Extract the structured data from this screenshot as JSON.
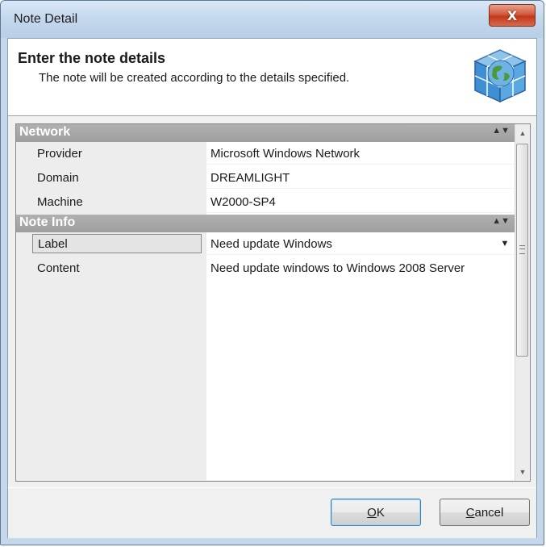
{
  "window": {
    "title": "Note Detail",
    "close_glyph": "X"
  },
  "header": {
    "title": "Enter the note details",
    "subtitle": "The note will be created according to the details specified.",
    "icon": "cube-globe-icon"
  },
  "property_grid": {
    "categories": [
      {
        "label": "Network",
        "rows": [
          {
            "name": "Provider",
            "value": "Microsoft Windows Network"
          },
          {
            "name": "Domain",
            "value": "DREAMLIGHT"
          },
          {
            "name": "Machine",
            "value": "W2000-SP4"
          }
        ]
      },
      {
        "label": "Note Info",
        "rows": [
          {
            "name": "Label",
            "value": "Need update Windows"
          },
          {
            "name": "Content",
            "value": "Need update windows to Windows 2008 Server"
          }
        ]
      }
    ],
    "selected_row": "Label"
  },
  "buttons": {
    "ok_mnemonic": "O",
    "ok_rest": "K",
    "cancel_mnemonic": "C",
    "cancel_rest": "ancel"
  },
  "colors": {
    "category_header": "#9e9e9e",
    "close_button": "#c3381a",
    "titlebar": "#c3d7ec"
  }
}
